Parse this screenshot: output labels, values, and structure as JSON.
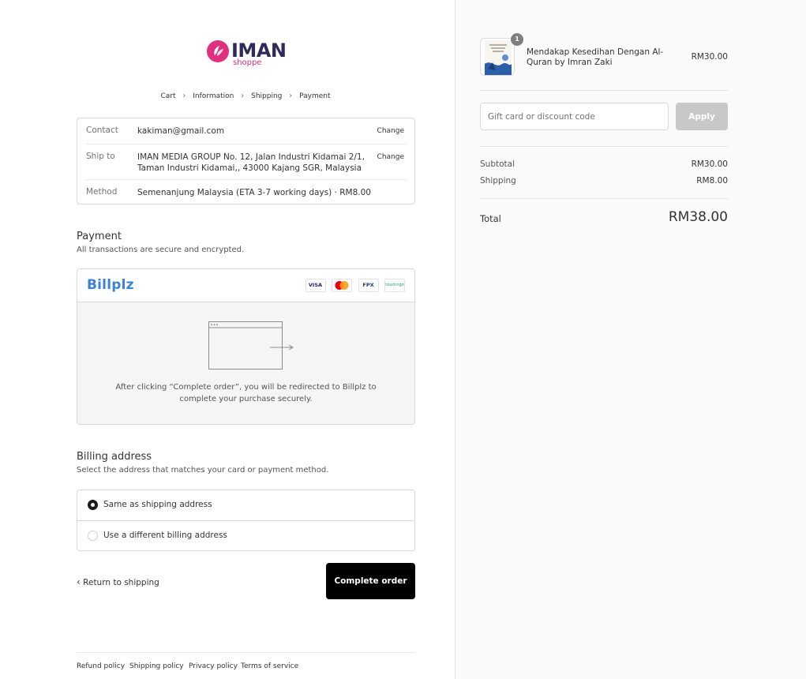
{
  "brand": {
    "logo_text": "IMAN",
    "logo_sub": "shoppe",
    "accent": "#e0307f",
    "navy": "#2e2a5c"
  },
  "breadcrumb": [
    "Cart",
    "Information",
    "Shipping",
    "Payment"
  ],
  "review": {
    "contact_label": "Contact",
    "contact_value": "kakiman@gmail.com",
    "shipto_label": "Ship to",
    "shipto_value": "IMAN MEDIA GROUP No. 12, Jalan Industri Kidamai 2/1, Taman Industri Kidamai,, 43000 Kajang SGR, Malaysia",
    "method_label": "Method",
    "method_value": "Semenanjung Malaysia (ETA 3-7 working days) · RM8.00",
    "change_label": "Change"
  },
  "payment": {
    "title": "Payment",
    "subtitle": "All transactions are secure and encrypted.",
    "provider": "Billplz",
    "badges": [
      "VISA",
      "mastercard",
      "FPX",
      "touchngo"
    ],
    "redirect_message": "After clicking “Complete order”, you will be redirected to Billplz to complete your purchase securely."
  },
  "billing": {
    "title": "Billing address",
    "subtitle": "Select the address that matches your card or payment method.",
    "options": [
      {
        "label": "Same as shipping address",
        "selected": true
      },
      {
        "label": "Use a different billing address",
        "selected": false
      }
    ]
  },
  "actions": {
    "return_label": "Return to shipping",
    "complete_label": "Complete order"
  },
  "footer": [
    "Refund policy",
    "Shipping policy",
    "Privacy policy",
    "Terms of service"
  ],
  "cart": {
    "item_name": "Mendakap Kesedihan Dengan Al-Quran by Imran Zaki",
    "item_qty": "1",
    "item_price": "RM30.00",
    "discount_placeholder": "Gift card or discount code",
    "apply_label": "Apply",
    "subtotal_label": "Subtotal",
    "subtotal_value": "RM30.00",
    "shipping_label": "Shipping",
    "shipping_value": "RM8.00",
    "total_label": "Total",
    "total_value": "RM38.00"
  }
}
